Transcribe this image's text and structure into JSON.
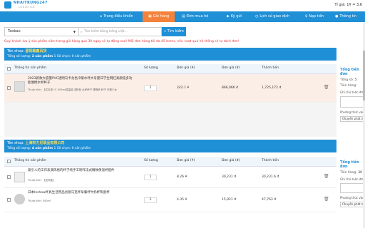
{
  "brand": {
    "name": "NHAITRUNG247",
    "tagline": "LOGISTICS"
  },
  "rate": "Tỉ giá: 1¥ = 3,6",
  "nav": [
    {
      "label": "Trang điều khiển",
      "icon": "home-icon"
    },
    {
      "label": "Giỏ hàng",
      "icon": "cart-icon",
      "active": true
    },
    {
      "label": "Đơn mua hộ",
      "icon": "orders-icon"
    },
    {
      "label": "Ký gửi",
      "icon": "truck-icon"
    },
    {
      "label": "Lịch sử giao dịch",
      "icon": "history-icon"
    },
    {
      "label": "Nạp tiền",
      "icon": "wallet-icon"
    },
    {
      "label": "Thông tin",
      "icon": "user-icon"
    }
  ],
  "search": {
    "site": "Taobao",
    "placeholder": "Tìm kiếm bằng tiếng việt...",
    "button": "Tìm kiếm"
  },
  "notice": "Quý khách lưu ý sản phẩm nằm trong giỏ hàng quá 30 ngày sẽ tự động xoá! Mỗi đơn hàng tối đa 45 items, nếu vượt quá hệ thống sẽ tự tách đơn!",
  "columns": {
    "product": "Thông tin sản phẩm",
    "qty": "Số lượng",
    "price": "Đơn giá (¥)",
    "vnd": "Đơn giá (đ)",
    "total": "Thành tiền"
  },
  "shops": [
    {
      "name_label": "Tên shop:",
      "name": "邵阳颖鑫百货",
      "count_label": "Tổng số lượng:",
      "count": "2 sản phẩm",
      "item_label": "1 Số chọn: 0 sản phẩm",
      "items": [
        {
          "title": "2023新款大容量PVC透明马卡龙色冷暖水杯大号夏日学生网红高颜值多功能便携水杯杯子",
          "attr": "Thuộc tính: 【买五送一】500ml容量装 浅粉色 水杯杯子 透明杯 杯子 可爱少女",
          "qty": "2",
          "price": "242.1 ¥",
          "vnd": "866,066 đ",
          "total": "1,725,172 đ"
        }
      ],
      "summary": {
        "title": "Tổng tiền đơn",
        "qty_label": "Tổng số:",
        "qty": "5",
        "vnd_label": "Tiền hàng:",
        "vnd": "",
        "note": "Ghi chú toàn đơn",
        "ship_label": "Phương thức vận",
        "ship": "Chuyển phát nhanh"
      }
    },
    {
      "name_label": "Tên shop:",
      "name": "上海积力尼联品有限公司",
      "count_label": "Tổng số lượng:",
      "count": "4 sản phẩm",
      "item_label": "1 Số chọn: 0 sản phẩm",
      "items": [
        {
          "title": "吸引人的工作表演风格的杯子纯手工制作法式精致保温杯配件",
          "attr": "Thuộc tính: 【送杯盖】",
          "qty": "1",
          "price": "8.26 ¥",
          "vnd": "30,231 đ",
          "total": "30,231.6 đ"
        },
        {
          "title": "日本Inshow杯具生活用品创意马克杯早餐杯牛奶杯陶瓷杯",
          "attr": "Thuộc tính: 300ml",
          "qty": "3",
          "price": "4.35 ¥",
          "vnd": "15,921 đ",
          "total": "47,763 đ"
        }
      ],
      "summary": {
        "title": "Tổng tiền đơn",
        "qty_label": "Tiền hàng:",
        "qty": "30",
        "vnd_label": "",
        "vnd": "",
        "note": "Ghi chú toàn đơn",
        "ship_label": "Phương thức vận",
        "ship": "Chuyển phát nhanh"
      }
    }
  ]
}
